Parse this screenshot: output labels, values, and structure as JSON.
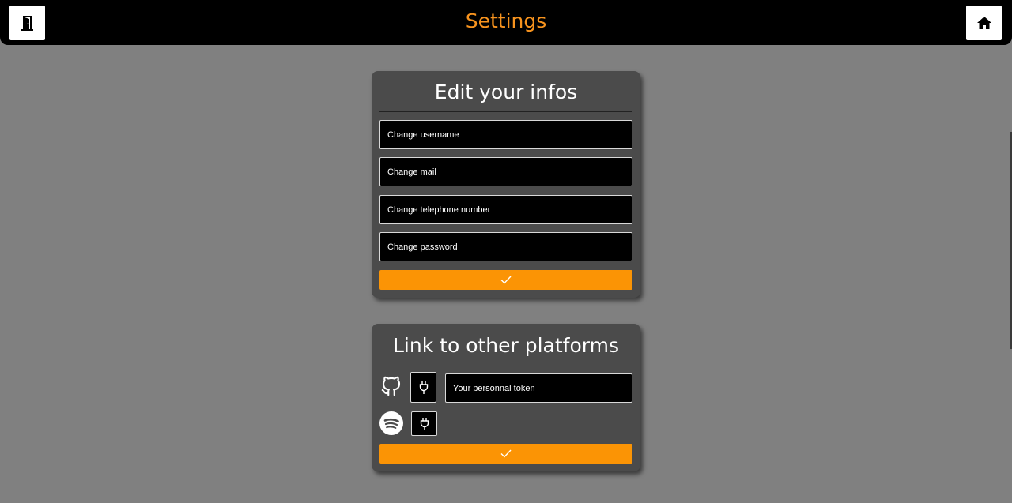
{
  "header": {
    "title": "Settings",
    "left_icon": "door-exit-icon",
    "right_icon": "home-icon"
  },
  "edit_infos": {
    "title": "Edit your infos",
    "fields": [
      {
        "placeholder": "Change username",
        "value": ""
      },
      {
        "placeholder": "Change mail",
        "value": ""
      },
      {
        "placeholder": "Change telephone number",
        "value": ""
      },
      {
        "placeholder": "Change password",
        "value": ""
      }
    ],
    "submit_icon": "checkmark-icon"
  },
  "platforms": {
    "title": "Link to other platforms",
    "items": [
      {
        "name_icon": "github-icon",
        "connect_icon": "plug-icon",
        "token_placeholder": "Your personnal token"
      },
      {
        "name_icon": "spotify-icon",
        "connect_icon": "plug-icon"
      }
    ],
    "submit_icon": "checkmark-icon"
  },
  "colors": {
    "accent": "#fb9405",
    "title_orange": "#f7931e",
    "background": "#808080",
    "card": "#4b4b4b"
  }
}
